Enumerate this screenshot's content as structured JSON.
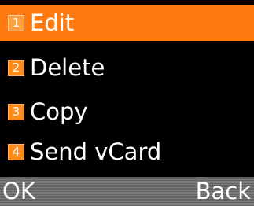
{
  "menu": {
    "items": [
      {
        "number": "1",
        "label": "Edit"
      },
      {
        "number": "2",
        "label": "Delete"
      },
      {
        "number": "3",
        "label": "Copy"
      },
      {
        "number": "4",
        "label": "Send vCard"
      }
    ],
    "selected_index": 0
  },
  "softkeys": {
    "left_label": "OK",
    "right_label": "Back"
  },
  "colors": {
    "highlight": "#ff7a10",
    "badge": "#ff8a1c",
    "background": "#000000",
    "softkey_bar": "#7a7a7a"
  }
}
